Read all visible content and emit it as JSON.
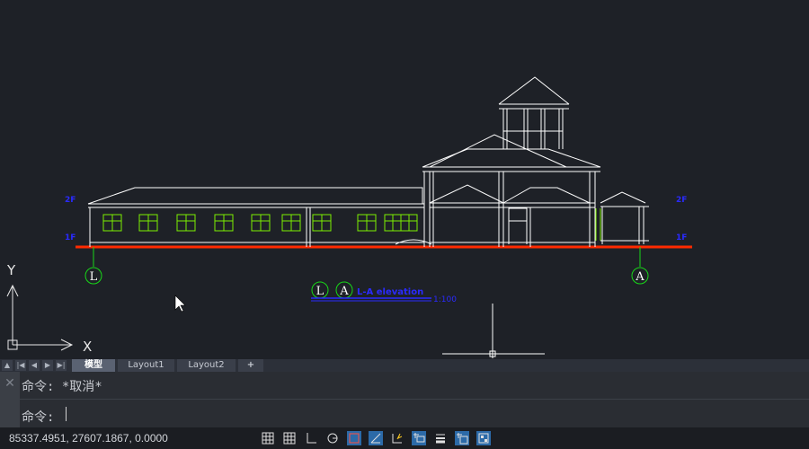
{
  "drawing": {
    "grid_left": "L",
    "grid_right": "A",
    "title_markers": [
      "L",
      "A"
    ],
    "title": "L-A elevation",
    "scale": "1:100",
    "level_labels": [
      "2F",
      "1F",
      "2F",
      "1F"
    ],
    "ucs_y": "Y",
    "ucs_x": "X"
  },
  "tabs": {
    "items": [
      "模型",
      "Layout1",
      "Layout2"
    ],
    "active": "模型",
    "add": "+"
  },
  "command": {
    "history": "命令: *取消*",
    "prompt": "命令:",
    "value": ""
  },
  "status": {
    "coordinates": "85337.4951, 27607.1867, 0.0000"
  },
  "toolbar_icons": [
    "grid-icon",
    "snap-icon",
    "ortho-icon",
    "polar-icon",
    "osnap-icon",
    "otrack-icon",
    "dynamic-ucs-icon",
    "dynamic-input-icon",
    "lineweight-icon",
    "transparency-icon",
    "workspace-icon"
  ],
  "colors": {
    "background": "#1e2127",
    "lines": "#ffffff",
    "windows": "#7cf000",
    "ground": "#ff2a00",
    "grid_bubble": "#18d818",
    "title": "#2020ff"
  }
}
